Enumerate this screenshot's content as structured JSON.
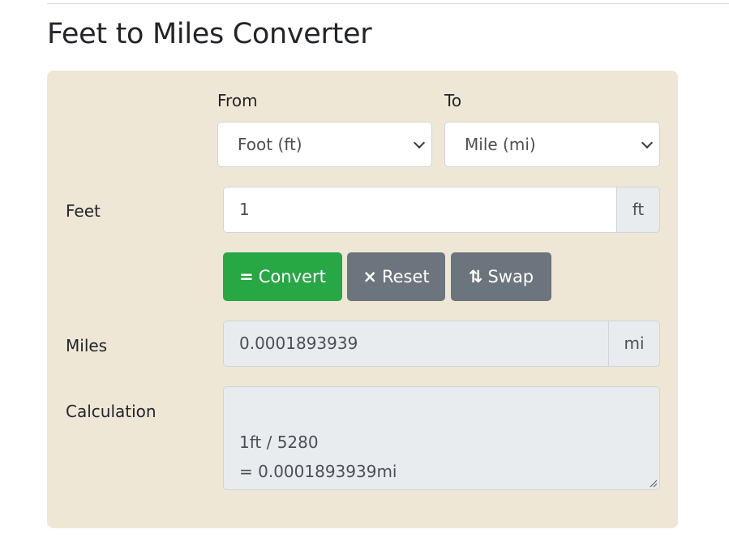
{
  "page": {
    "title": "Feet to Miles Converter"
  },
  "converter": {
    "from_label": "From",
    "to_label": "To",
    "from_select": {
      "selected": "Foot (ft)"
    },
    "to_select": {
      "selected": "Mile (mi)"
    },
    "input": {
      "label": "Feet",
      "value": "1",
      "unit": "ft"
    },
    "buttons": {
      "convert": {
        "icon": "=",
        "icon_name": "equals-icon",
        "label": "Convert"
      },
      "reset": {
        "icon": "×",
        "icon_name": "close-icon",
        "label": "Reset"
      },
      "swap": {
        "icon": "⇅",
        "icon_name": "swap-arrows-icon",
        "label": "Swap"
      }
    },
    "output": {
      "label": "Miles",
      "value": "0.0001893939",
      "unit": "mi"
    },
    "calculation": {
      "label": "Calculation",
      "text": "1ft / 5280\n= 0.0001893939mi"
    }
  },
  "colors": {
    "panel_bg": "#efe7d6",
    "convert_button": "#28a745",
    "secondary_button": "#6c757d",
    "readonly_bg": "#e9ecef"
  }
}
